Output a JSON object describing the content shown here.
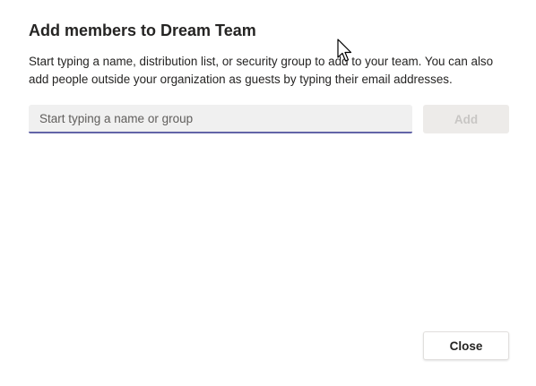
{
  "dialog": {
    "title": "Add members to Dream Team",
    "description": "Start typing a name, distribution list, or security group to add to your team. You can also add people outside your organization as guests by typing their email addresses."
  },
  "search": {
    "placeholder": "Start typing a name or group",
    "value": ""
  },
  "buttons": {
    "add_label": "Add",
    "close_label": "Close"
  },
  "colors": {
    "accent": "#6264a7",
    "text": "#252423",
    "input_background": "#f0f0f0",
    "disabled_button_background": "#edebe9",
    "disabled_button_text": "#c8c6c4"
  },
  "icons": {
    "pointer": "mouse-pointer-icon"
  }
}
